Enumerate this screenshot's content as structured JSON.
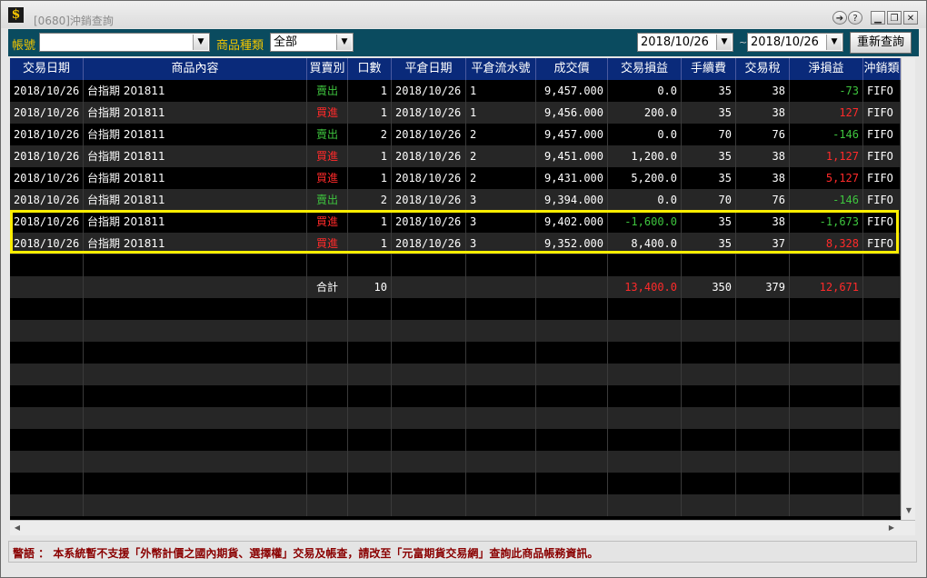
{
  "window": {
    "title": "[0680]沖銷查詢",
    "logo": "$"
  },
  "titlebar_buttons": {
    "nav": "➔",
    "help": "?",
    "minimize": "▁",
    "restore": "❐",
    "close": "✕"
  },
  "toolbar": {
    "account_label": "帳號",
    "account_value": "",
    "product_type_label": "商品種類",
    "product_type_value": "全部",
    "date_from": "2018/10/26",
    "date_separator": "~",
    "date_to": "2018/10/26",
    "requery_label": "重新查詢",
    "dropdown_arrow": "▼"
  },
  "table": {
    "headers": [
      "交易日期",
      "商品內容",
      "買賣別",
      "口數",
      "平倉日期",
      "平倉流水號",
      "成交價",
      "交易損益",
      "手續費",
      "交易稅",
      "淨損益",
      "沖銷類"
    ],
    "rows": [
      {
        "date": "2018/10/26",
        "product": "台指期 201811",
        "side": "賣出",
        "side_color": "#3ec43e",
        "qty": "1",
        "close_date": "2018/10/26",
        "seq": "1",
        "price": "9,457.000",
        "trade_pl": "0.0",
        "trade_pl_color": "#ffffff",
        "fee": "35",
        "tax": "38",
        "net": "-73",
        "net_color": "#3ec43e",
        "method": "FIFO"
      },
      {
        "date": "2018/10/26",
        "product": "台指期 201811",
        "side": "買進",
        "side_color": "#ff2a2a",
        "qty": "1",
        "close_date": "2018/10/26",
        "seq": "1",
        "price": "9,456.000",
        "trade_pl": "200.0",
        "trade_pl_color": "#ffffff",
        "fee": "35",
        "tax": "38",
        "net": "127",
        "net_color": "#ff2a2a",
        "method": "FIFO"
      },
      {
        "date": "2018/10/26",
        "product": "台指期 201811",
        "side": "賣出",
        "side_color": "#3ec43e",
        "qty": "2",
        "close_date": "2018/10/26",
        "seq": "2",
        "price": "9,457.000",
        "trade_pl": "0.0",
        "trade_pl_color": "#ffffff",
        "fee": "70",
        "tax": "76",
        "net": "-146",
        "net_color": "#3ec43e",
        "method": "FIFO"
      },
      {
        "date": "2018/10/26",
        "product": "台指期 201811",
        "side": "買進",
        "side_color": "#ff2a2a",
        "qty": "1",
        "close_date": "2018/10/26",
        "seq": "2",
        "price": "9,451.000",
        "trade_pl": "1,200.0",
        "trade_pl_color": "#ffffff",
        "fee": "35",
        "tax": "38",
        "net": "1,127",
        "net_color": "#ff2a2a",
        "method": "FIFO"
      },
      {
        "date": "2018/10/26",
        "product": "台指期 201811",
        "side": "買進",
        "side_color": "#ff2a2a",
        "qty": "1",
        "close_date": "2018/10/26",
        "seq": "2",
        "price": "9,431.000",
        "trade_pl": "5,200.0",
        "trade_pl_color": "#ffffff",
        "fee": "35",
        "tax": "38",
        "net": "5,127",
        "net_color": "#ff2a2a",
        "method": "FIFO"
      },
      {
        "date": "2018/10/26",
        "product": "台指期 201811",
        "side": "賣出",
        "side_color": "#3ec43e",
        "qty": "2",
        "close_date": "2018/10/26",
        "seq": "3",
        "price": "9,394.000",
        "trade_pl": "0.0",
        "trade_pl_color": "#ffffff",
        "fee": "70",
        "tax": "76",
        "net": "-146",
        "net_color": "#3ec43e",
        "method": "FIFO"
      },
      {
        "date": "2018/10/26",
        "product": "台指期 201811",
        "side": "買進",
        "side_color": "#ff2a2a",
        "qty": "1",
        "close_date": "2018/10/26",
        "seq": "3",
        "price": "9,402.000",
        "trade_pl": "-1,600.0",
        "trade_pl_color": "#3ec43e",
        "fee": "35",
        "tax": "38",
        "net": "-1,673",
        "net_color": "#3ec43e",
        "method": "FIFO"
      },
      {
        "date": "2018/10/26",
        "product": "台指期 201811",
        "side": "買進",
        "side_color": "#ff2a2a",
        "qty": "1",
        "close_date": "2018/10/26",
        "seq": "3",
        "price": "9,352.000",
        "trade_pl": "8,400.0",
        "trade_pl_color": "#ffffff",
        "fee": "35",
        "tax": "37",
        "net": "8,328",
        "net_color": "#ff2a2a",
        "method": "FIFO"
      }
    ],
    "total": {
      "label": "合計",
      "qty": "10",
      "trade_pl": "13,400.0",
      "fee": "350",
      "tax": "379",
      "net": "12,671"
    }
  },
  "colors": {
    "header_bg": "#0a2a7a",
    "toolbar_bg": "#0a4b5f",
    "highlight": "#ffee00",
    "profit": "#ff2a2a",
    "loss": "#3ec43e"
  },
  "status_text": "警語 ： 本系統暫不支援「外幣計價之國內期貨、選擇權」交易及帳查，請改至「元富期貨交易網」查詢此商品帳務資訊。"
}
